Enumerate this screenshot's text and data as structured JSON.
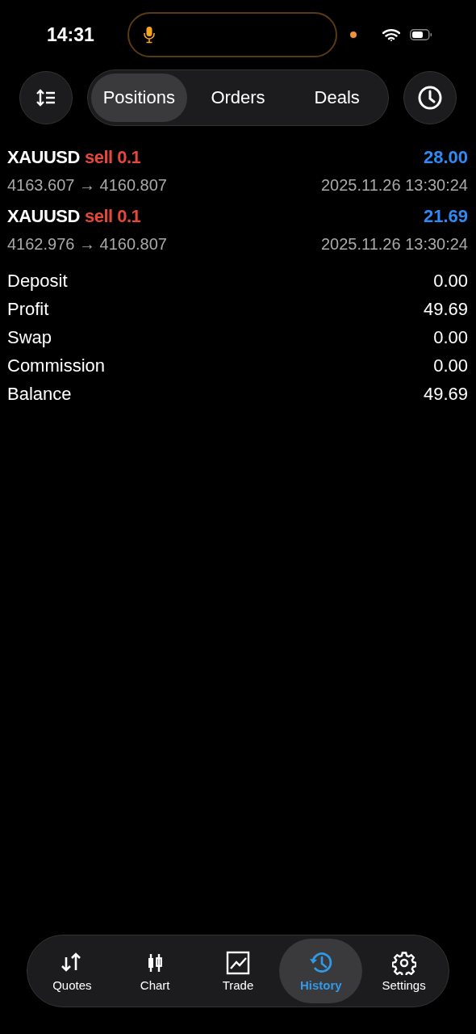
{
  "status_bar": {
    "time": "14:31"
  },
  "tabs": [
    {
      "label": "Positions",
      "selected": true
    },
    {
      "label": "Orders",
      "selected": false
    },
    {
      "label": "Deals",
      "selected": false
    }
  ],
  "deals": [
    {
      "symbol": "XAUUSD",
      "action": "sell 0.1",
      "profit": "28.00",
      "prices": "4163.607 → 4160.807",
      "time": "2025.11.26 13:30:24"
    },
    {
      "symbol": "XAUUSD",
      "action": "sell 0.1",
      "profit": "21.69",
      "prices": "4162.976 → 4160.807",
      "time": "2025.11.26 13:30:24"
    }
  ],
  "summary": [
    {
      "label": "Deposit",
      "value": "0.00"
    },
    {
      "label": "Profit",
      "value": "49.69"
    },
    {
      "label": "Swap",
      "value": "0.00"
    },
    {
      "label": "Commission",
      "value": "0.00"
    },
    {
      "label": "Balance",
      "value": "49.69"
    }
  ],
  "nav": [
    {
      "label": "Quotes",
      "selected": false
    },
    {
      "label": "Chart",
      "selected": false
    },
    {
      "label": "Trade",
      "selected": false
    },
    {
      "label": "History",
      "selected": true
    },
    {
      "label": "Settings",
      "selected": false
    }
  ]
}
